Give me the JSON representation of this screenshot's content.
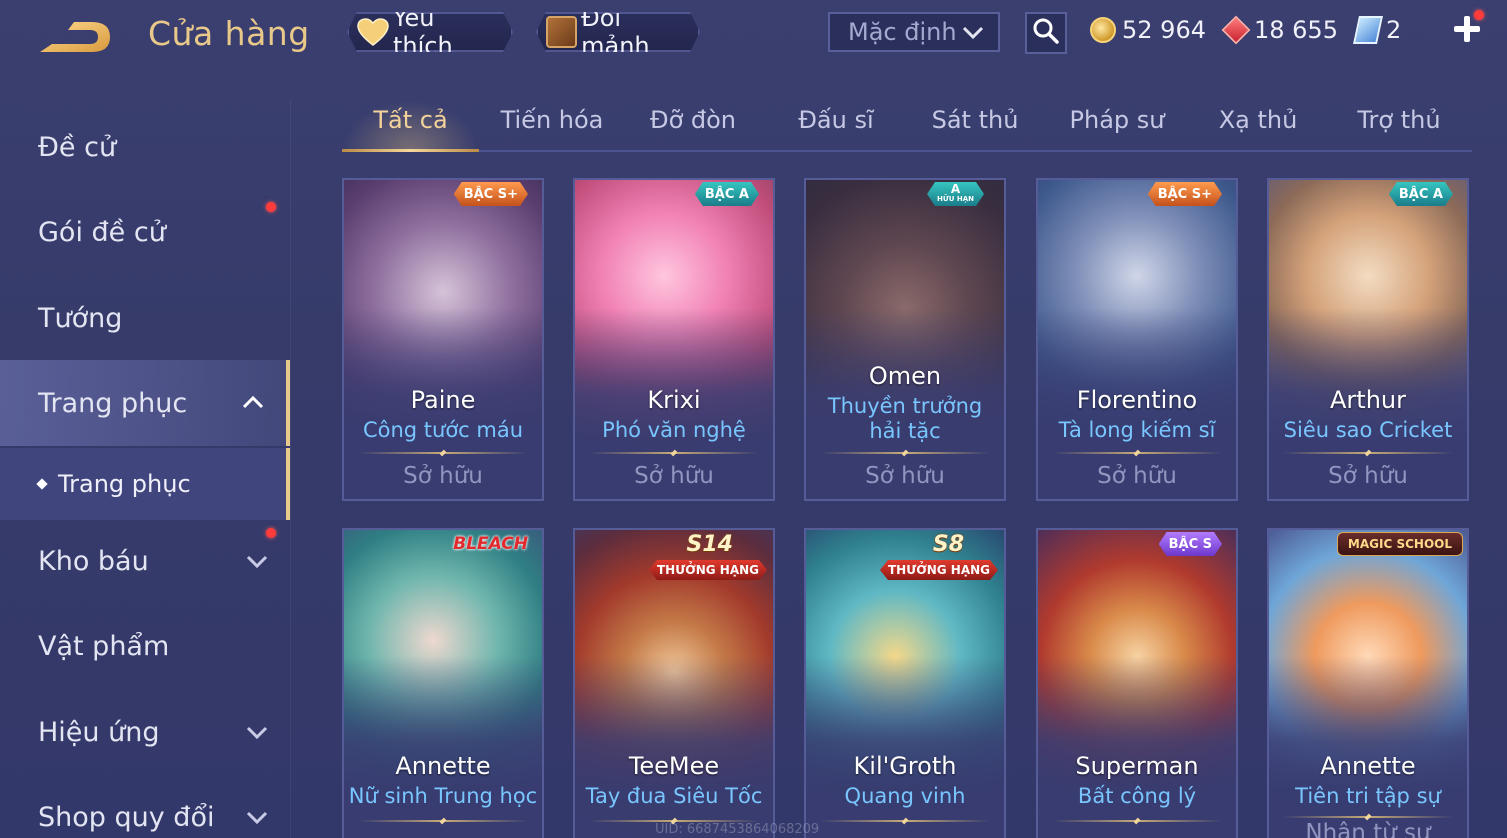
{
  "header": {
    "title": "Cửa hàng",
    "favorite_label": "Yêu thích",
    "exchange_label": "Đổi mảnh",
    "sort_value": "Mặc định",
    "currencies": [
      {
        "icon": "gold-coin-icon",
        "value": "52 964"
      },
      {
        "icon": "red-gem-icon",
        "value": "18 655"
      },
      {
        "icon": "ticket-icon",
        "value": "2"
      }
    ]
  },
  "sidebar": {
    "items": [
      {
        "label": "Đề cử"
      },
      {
        "label": "Gói đề cử"
      },
      {
        "label": "Tướng"
      },
      {
        "label": "Trang phục"
      },
      {
        "label": "Kho báu"
      },
      {
        "label": "Vật phẩm"
      },
      {
        "label": "Hiệu ứng"
      },
      {
        "label": "Shop quy đổi"
      }
    ],
    "sub_item": "Trang phục"
  },
  "tabs": [
    "Tất cả",
    "Tiến hóa",
    "Đỡ đòn",
    "Đấu sĩ",
    "Sát thủ",
    "Pháp sư",
    "Xạ thủ",
    "Trợ thủ"
  ],
  "cards": [
    {
      "hero": "Paine",
      "skin": "Công tước máu",
      "status": "Sở hữu",
      "badge": "BẬC S+"
    },
    {
      "hero": "Krixi",
      "skin": "Phó văn nghệ",
      "status": "Sở hữu",
      "badge": "BẬC A"
    },
    {
      "hero": "Omen",
      "skin": "Thuyền trưởng hải tặc",
      "status": "Sở hữu",
      "badge": "A",
      "badge_sub": "HỮU HẠN"
    },
    {
      "hero": "Florentino",
      "skin": "Tà long kiếm sĩ",
      "status": "Sở hữu",
      "badge": "BẬC S+"
    },
    {
      "hero": "Arthur",
      "skin": "Siêu sao Cricket",
      "status": "Sở hữu",
      "badge": "BẬC A"
    },
    {
      "hero": "Annette",
      "skin": "Nữ sinh Trung học",
      "status": "",
      "badge": "BLEACH"
    },
    {
      "hero": "TeeMee",
      "skin": "Tay đua Siêu Tốc",
      "status": "",
      "badge": "THƯỞNG HẠNG",
      "season": "S14"
    },
    {
      "hero": "Kil'Groth",
      "skin": "Quang vinh",
      "status": "",
      "badge": "THƯỞNG HẠNG",
      "season": "S8"
    },
    {
      "hero": "Superman",
      "skin": "Bất công lý",
      "status": "",
      "badge": "BẬC S"
    },
    {
      "hero": "Annette",
      "skin": "Tiên tri tập sự",
      "status": "Nhận từ sự",
      "badge": "MAGIC SCHOOL"
    }
  ],
  "watermark": "UID: 6687453864068209"
}
